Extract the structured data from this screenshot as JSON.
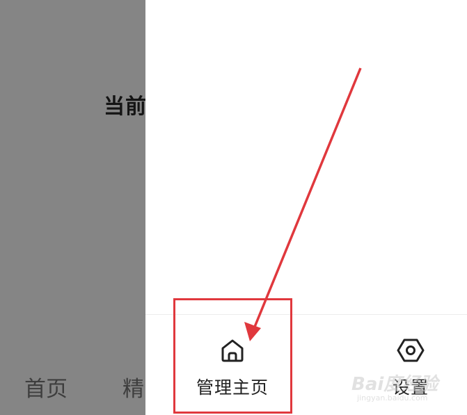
{
  "background_page": {
    "title": "当前",
    "tabs": [
      {
        "label": "首页"
      },
      {
        "label": "精"
      }
    ]
  },
  "drawer": {
    "items": [
      {
        "label": "管理主页",
        "icon": "home-icon"
      },
      {
        "label": "设置",
        "icon": "settings-icon"
      }
    ]
  },
  "annotation": {
    "highlight_color": "#e0383d",
    "arrow_color": "#e0383d"
  },
  "watermark": {
    "text": "Bai度经验",
    "sub": "jingyan.baidu.com"
  }
}
